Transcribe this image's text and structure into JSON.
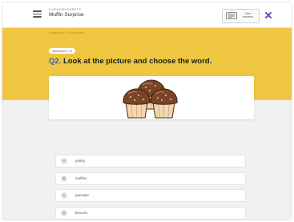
{
  "header": {
    "small_label": "LIVEWORKSHEETS",
    "set_title": "Muffin Surprise",
    "view_answers": "View answers"
  },
  "breadcrumb": "Vocabulary › Food words",
  "question": {
    "badge": "Question 2 / 5",
    "number": "Q2.",
    "text": "Look at the picture and choose the word."
  },
  "options": [
    {
      "letter": "A",
      "text": "pastry"
    },
    {
      "letter": "B",
      "text": "muffins"
    },
    {
      "letter": "C",
      "text": "pancake"
    },
    {
      "letter": "D",
      "text": "biscuits"
    }
  ],
  "colors": {
    "band": "#efc640",
    "question_number": "#2f63a8",
    "close": "#6a4fb3"
  }
}
